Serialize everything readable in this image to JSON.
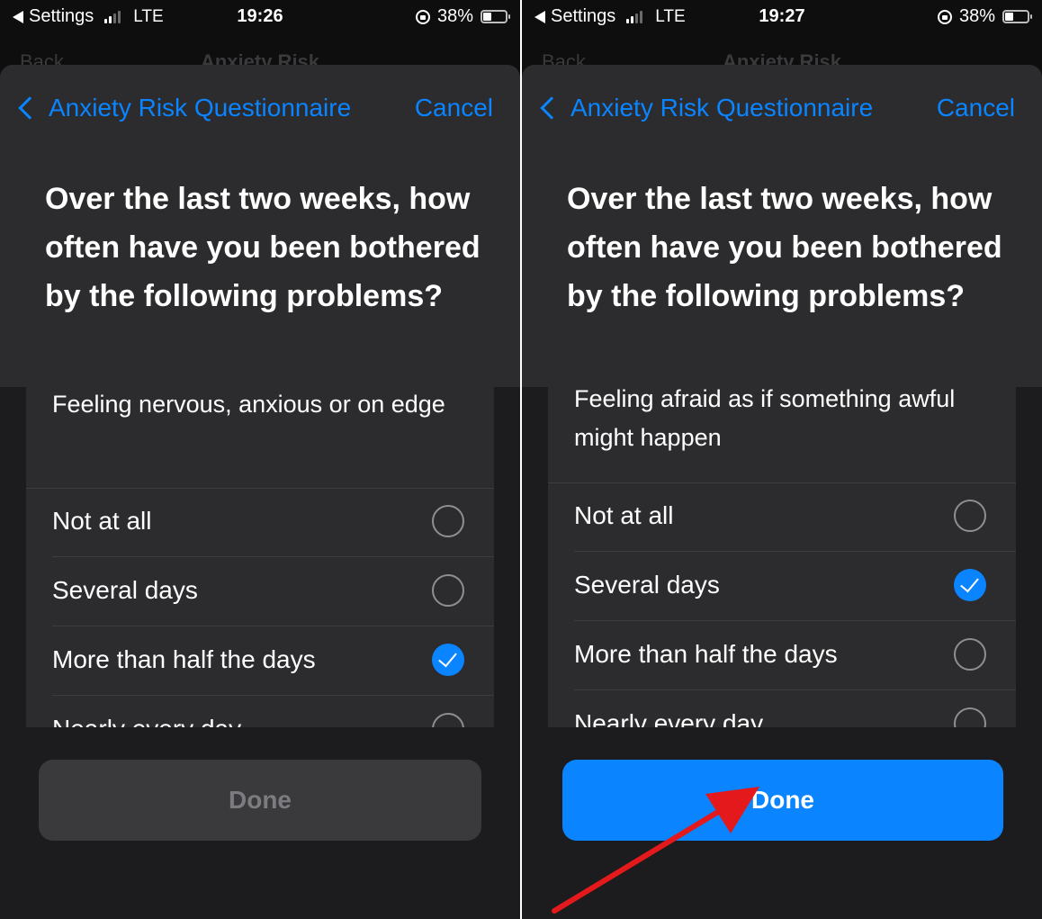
{
  "colors": {
    "accent": "#0a84ff",
    "annotation_arrow": "#e3191c",
    "sheet_bg": "#1c1c1e",
    "card_bg": "#2c2c2e"
  },
  "left": {
    "status": {
      "back_app": "Settings",
      "network": "LTE",
      "time": "19:26",
      "battery": "38%"
    },
    "ghost_nav": {
      "back": "Back",
      "title": "Anxiety Risk"
    },
    "nav": {
      "back_label": "Anxiety Risk Questionnaire",
      "cancel_label": "Cancel"
    },
    "question": "Over the last two weeks, how often have you been bothered by the following problems?",
    "item": "Feeling nervous, anxious or on edge",
    "options": [
      {
        "label": "Not at all",
        "selected": false
      },
      {
        "label": "Several days",
        "selected": false
      },
      {
        "label": "More than half the days",
        "selected": true
      },
      {
        "label": "Nearly every day",
        "selected": false
      }
    ],
    "done_label": "Done",
    "done_enabled": false
  },
  "right": {
    "status": {
      "back_app": "Settings",
      "network": "LTE",
      "time": "19:27",
      "battery": "38%"
    },
    "ghost_nav": {
      "back": "Back",
      "title": "Anxiety Risk"
    },
    "nav": {
      "back_label": "Anxiety Risk Questionnaire",
      "cancel_label": "Cancel"
    },
    "question": "Over the last two weeks, how often have you been bothered by the following problems?",
    "item": "Feeling afraid as if something awful might happen",
    "options": [
      {
        "label": "Not at all",
        "selected": false
      },
      {
        "label": "Several days",
        "selected": true
      },
      {
        "label": "More than half the days",
        "selected": false
      },
      {
        "label": "Nearly every day",
        "selected": false
      }
    ],
    "done_label": "Done",
    "done_enabled": true
  }
}
